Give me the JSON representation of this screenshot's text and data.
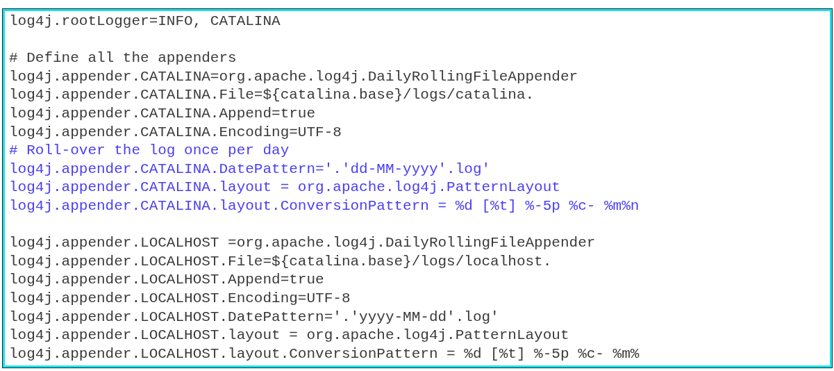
{
  "lines": [
    {
      "kind": "code",
      "text": "log4j.rootLogger=INFO, CATALINA",
      "highlighted": false
    },
    {
      "kind": "blank"
    },
    {
      "kind": "code",
      "text": "# Define all the appenders",
      "highlighted": false
    },
    {
      "kind": "code",
      "text": "log4j.appender.CATALINA=org.apache.log4j.DailyRollingFileAppender",
      "highlighted": false
    },
    {
      "kind": "code",
      "text": "log4j.appender.CATALINA.File=${catalina.base}/logs/catalina.",
      "highlighted": false
    },
    {
      "kind": "code",
      "text": "log4j.appender.CATALINA.Append=true",
      "highlighted": false
    },
    {
      "kind": "code",
      "text": "log4j.appender.CATALINA.Encoding=UTF-8",
      "highlighted": false
    },
    {
      "kind": "code",
      "text": "# Roll-over the log once per day",
      "highlighted": true
    },
    {
      "kind": "code",
      "text": "log4j.appender.CATALINA.DatePattern='.'dd-MM-yyyy'.log'",
      "highlighted": true
    },
    {
      "kind": "code",
      "text": "log4j.appender.CATALINA.layout = org.apache.log4j.PatternLayout",
      "highlighted": true
    },
    {
      "kind": "code",
      "text": "log4j.appender.CATALINA.layout.ConversionPattern = %d [%t] %-5p %c- %m%n",
      "highlighted": true
    },
    {
      "kind": "blank"
    },
    {
      "kind": "code",
      "text": "log4j.appender.LOCALHOST =org.apache.log4j.DailyRollingFileAppender",
      "highlighted": false
    },
    {
      "kind": "code",
      "text": "log4j.appender.LOCALHOST.File=${catalina.base}/logs/localhost.",
      "highlighted": false
    },
    {
      "kind": "code",
      "text": "log4j.appender.LOCALHOST.Append=true",
      "highlighted": false
    },
    {
      "kind": "code",
      "text": "log4j.appender.LOCALHOST.Encoding=UTF-8",
      "highlighted": false
    },
    {
      "kind": "code",
      "text": "log4j.appender.LOCALHOST.DatePattern='.'yyyy-MM-dd'.log'",
      "highlighted": false
    },
    {
      "kind": "code",
      "text": "log4j.appender.LOCALHOST.layout = org.apache.log4j.PatternLayout",
      "highlighted": false
    },
    {
      "kind": "code",
      "text": "log4j.appender.LOCALHOST.layout.ConversionPattern = %d [%t] %-5p %c- %m%",
      "highlighted": false
    }
  ]
}
